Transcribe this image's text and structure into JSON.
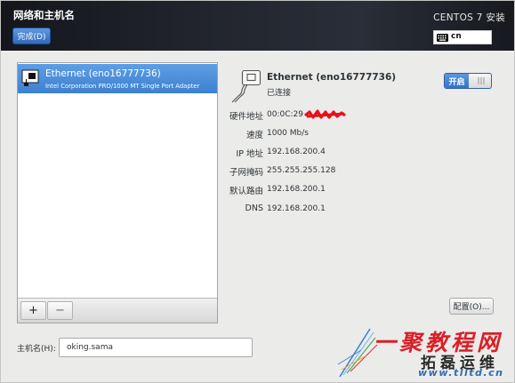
{
  "header": {
    "title": "网络和主机名",
    "done_label": "完成(D)",
    "product": "CENTOS 7 安装",
    "keyboard_icon": "keyboard-icon",
    "keyboard_layout": "cn"
  },
  "device_list": {
    "items": [
      {
        "icon": "network-card-icon",
        "name": "Ethernet (eno16777736)",
        "description": "Intel Corporation PRO/1000 MT Single Port Adapter",
        "selected": true
      }
    ],
    "add_label": "+",
    "remove_label": "−"
  },
  "details": {
    "icon": "network-wired-icon",
    "title": "Ethernet (eno16777736)",
    "status": "已连接",
    "toggle": {
      "label": "开启",
      "on": true
    },
    "rows": [
      {
        "label": "硬件地址",
        "value": "00:0C:29"
      },
      {
        "label": "速度",
        "value": "1000 Mb/s"
      },
      {
        "label": "IP 地址",
        "value": "192.168.200.4"
      },
      {
        "label": "子网掩码",
        "value": "255.255.255.128"
      },
      {
        "label": "默认路由",
        "value": "192.168.200.1"
      },
      {
        "label": "DNS",
        "value": "192.168.200.1"
      }
    ],
    "configure_label": "配置(O)..."
  },
  "hostname": {
    "label": "主机名(H):",
    "value": "oking.sama"
  },
  "watermark": {
    "brand": "一聚教程网",
    "site_name": "拓磊运维",
    "url": "www.tlltd.cn"
  },
  "colors": {
    "header_bg": "#1f222b",
    "selected_row": "#4a8dd8",
    "accent": "#3c7fd0",
    "redaction": "#e8101a",
    "watermark_red": "#d91f26"
  }
}
